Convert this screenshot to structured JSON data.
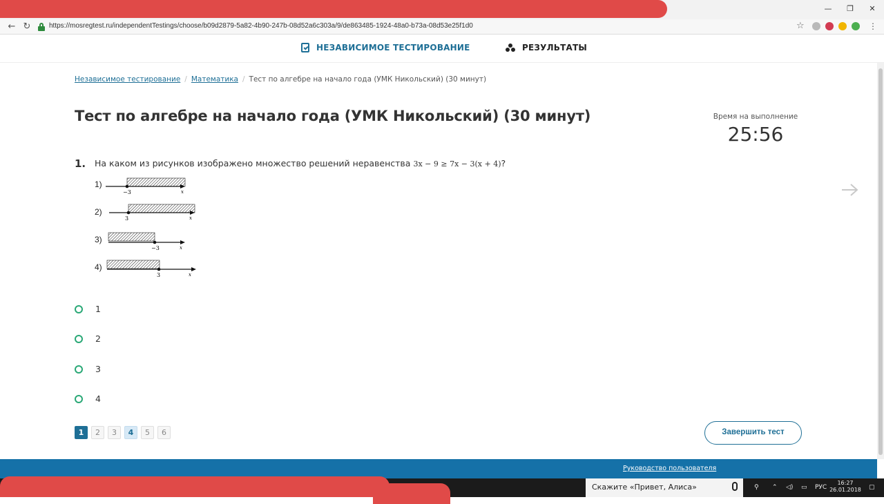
{
  "browser": {
    "url": "https://mosregtest.ru/independentTestings/choose/b09d2879-5a82-4b90-247b-08d52a6c303a/9/de863485-1924-48a0-b73a-08d53e25f1d0",
    "window_controls": [
      "—",
      "❐",
      "✕"
    ],
    "back": "←",
    "refresh": "↻",
    "star": "☆",
    "menu": "⋮"
  },
  "nav": {
    "active_label": "НЕЗАВИСИМОЕ ТЕСТИРОВАНИЕ",
    "results_label": "РЕЗУЛЬТАТЫ"
  },
  "breadcrumb": {
    "items": [
      "Независимое тестирование",
      "Математика",
      "Тест по алгебре на начало года (УМК Никольский) (30 минут)"
    ],
    "separator": "/"
  },
  "page": {
    "title": "Тест по алгебре на начало года (УМК Никольский) (30 минут)"
  },
  "timer": {
    "label": "Время на выполнение",
    "value": "25:56"
  },
  "question": {
    "number": "1.",
    "text": "На каком из рисунков изображено множество решений неравенства",
    "math": "3x − 9 ≥ 7x − 3(x + 4)",
    "end": "?",
    "figures": [
      {
        "label": "1)",
        "point": "−3",
        "axis": "x"
      },
      {
        "label": "2)",
        "point": "3",
        "axis": "x"
      },
      {
        "label": "3)",
        "point": "−3",
        "axis": "x"
      },
      {
        "label": "4)",
        "point": "3",
        "axis": "x"
      }
    ]
  },
  "answers": [
    "1",
    "2",
    "3",
    "4"
  ],
  "pager": [
    "1",
    "2",
    "3",
    "4",
    "5",
    "6"
  ],
  "finish_button": "Завершить тест",
  "footer": {
    "link": "Руководство пользователя"
  },
  "taskbar": {
    "search": "Скажите «Привет, Алиса»",
    "lang": "РУС",
    "time": "16:27",
    "date": "26.01.2018"
  },
  "colors": {
    "accent": "#1e6f96",
    "footer": "#1571a8",
    "radio": "#2aa876",
    "redaction": "#e04a48"
  }
}
